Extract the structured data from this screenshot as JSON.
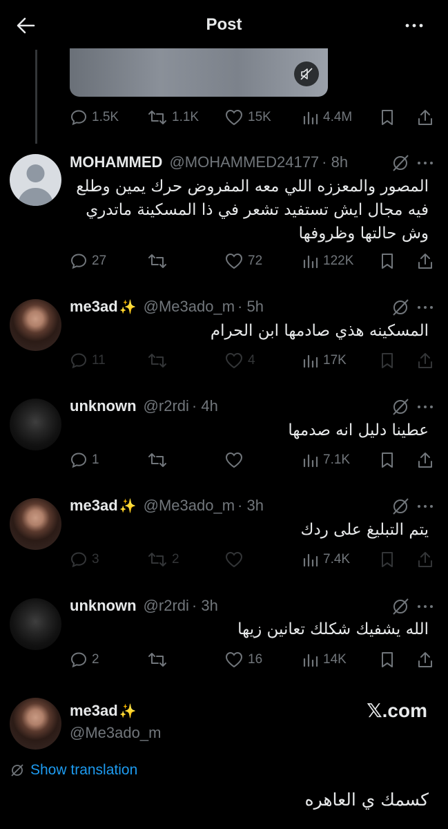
{
  "header": {
    "title": "Post",
    "back_icon": "arrow-left-icon",
    "more_icon": "more-dots-icon"
  },
  "main_post_stats": {
    "replies": "1.5K",
    "reposts": "1.1K",
    "likes": "15K",
    "views": "4.4M"
  },
  "replies": [
    {
      "name": "MOHAMMED",
      "verified_sparkle": "",
      "handle": "@MOHAMMED24177",
      "time": "· 8h",
      "text": "المصور والمعززه اللي معه المفروض حرك يمين وطلع فيه مجال ايش تستفيد تشعر في ذا المسكينة ماتدري وش حالتها وظروفها",
      "stats": {
        "replies": "27",
        "reposts": "",
        "likes": "72",
        "views": "122K"
      }
    },
    {
      "name": "me3ad",
      "verified_sparkle": "✨",
      "handle": "@Me3ado_m",
      "time": "· 5h",
      "text": "المسكينه هذي صادمها ابن الحرام",
      "stats": {
        "replies": "11",
        "reposts": "",
        "likes": "4",
        "views": "17K"
      }
    },
    {
      "name": "unknown",
      "verified_sparkle": "",
      "handle": "@r2rdi",
      "time": "· 4h",
      "text": "عطينا دليل انه صدمها",
      "stats": {
        "replies": "1",
        "reposts": "",
        "likes": "",
        "views": "7.1K"
      }
    },
    {
      "name": "me3ad",
      "verified_sparkle": "✨",
      "handle": "@Me3ado_m",
      "time": "· 3h",
      "text": "يتم التبليغ على ردك",
      "stats": {
        "replies": "3",
        "reposts": "2",
        "likes": "",
        "views": "7.4K"
      }
    },
    {
      "name": "unknown",
      "verified_sparkle": "",
      "handle": "@r2rdi",
      "time": "· 3h",
      "text": "الله يشفيك شكلك تعانين زيها",
      "stats": {
        "replies": "2",
        "reposts": "",
        "likes": "16",
        "views": "14K"
      }
    }
  ],
  "focused_post": {
    "name": "me3ad",
    "verified_sparkle": "✨",
    "handle": "@Me3ado_m",
    "brand": "𝕏.com",
    "translate_label": "Show translation",
    "text": "كسمك ي العاهره"
  },
  "colors": {
    "background": "#000000",
    "text": "#e7e9ea",
    "muted": "#71767b",
    "accent": "#1d9bf0",
    "thread_line": "#333639"
  }
}
